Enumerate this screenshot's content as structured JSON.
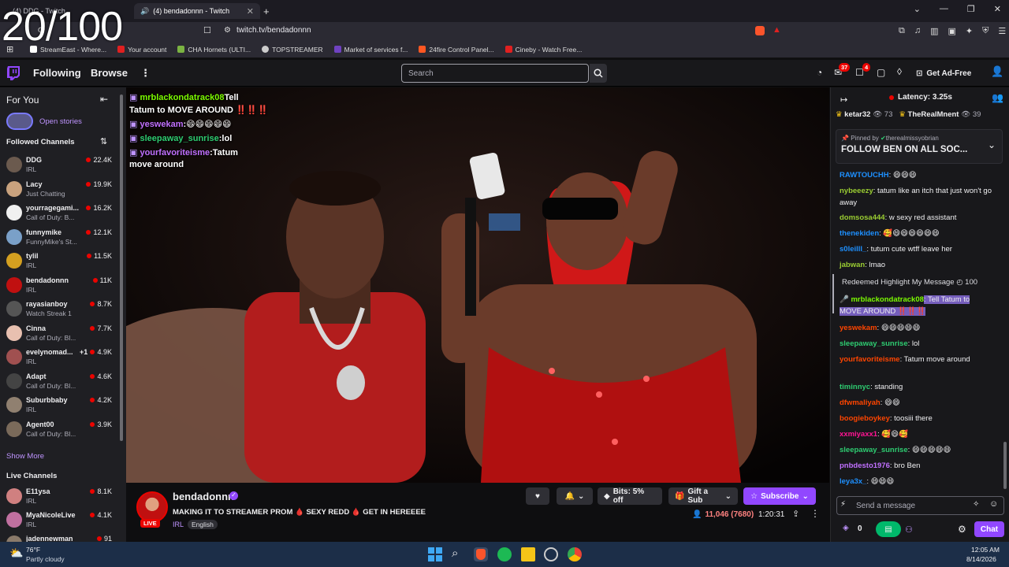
{
  "overlay_counter": "20/100",
  "browser": {
    "tabs": [
      {
        "label": "(4) DDG - Twitch"
      },
      {
        "label": "(4) bendadonnn - Twitch"
      }
    ],
    "url": "twitch.tv/bendadonnn",
    "bookmarks": [
      {
        "label": "StreamEast - Where...",
        "color": "#ffffff"
      },
      {
        "label": "Your account",
        "color": "#e02020"
      },
      {
        "label": "CHA Hornets (ULTI...",
        "color": "#7bb342"
      },
      {
        "label": "TOPSTREAMER",
        "color": "#cccccc"
      },
      {
        "label": "Market of services f...",
        "color": "#6f42c1"
      },
      {
        "label": "24fire Control Panel...",
        "color": "#ff5722"
      },
      {
        "label": "Cineby - Watch Free...",
        "color": "#e02020"
      }
    ]
  },
  "topnav": {
    "following": "Following",
    "browse": "Browse",
    "more": "⋮",
    "search_placeholder": "Search",
    "notif_count_1": "37",
    "notif_count_2": "4",
    "ad_free": "Get Ad-Free"
  },
  "sidebar": {
    "for_you": "For You",
    "open_stories": "Open stories",
    "followed_channels": "Followed Channels",
    "channels": [
      {
        "name": "DDG",
        "game": "IRL",
        "viewers": "22.4K",
        "color": "#6b5a4e"
      },
      {
        "name": "Lacy",
        "game": "Just Chatting",
        "viewers": "19.9K",
        "color": "#c9a27e"
      },
      {
        "name": "yourragegami...",
        "game": "Call of Duty: B...",
        "viewers": "16.2K",
        "color": "#f0f0f0"
      },
      {
        "name": "funnymike",
        "game": "FunnyMike's St...",
        "viewers": "12.1K",
        "color": "#7aa0c8"
      },
      {
        "name": "tylil",
        "game": "IRL",
        "viewers": "11.5K",
        "color": "#d4a020"
      },
      {
        "name": "bendadonnn",
        "game": "IRL",
        "viewers": "11K",
        "color": "#c01010"
      },
      {
        "name": "rayasianboy",
        "game": "Watch Streak 1",
        "viewers": "8.7K",
        "color": "#555555"
      },
      {
        "name": "Cinna",
        "game": "Call of Duty: Bl...",
        "viewers": "7.7K",
        "color": "#e8c0b0"
      },
      {
        "name": "evelynomad...",
        "extra": "+1",
        "game": "IRL",
        "viewers": "4.9K",
        "color": "#a05050"
      },
      {
        "name": "Adapt",
        "game": "Call of Duty: Bl...",
        "viewers": "4.6K",
        "color": "#444444"
      },
      {
        "name": "Suburbbaby",
        "game": "IRL",
        "viewers": "4.2K",
        "color": "#908070"
      },
      {
        "name": "Agent00",
        "game": "Call of Duty: Bl...",
        "viewers": "3.9K",
        "color": "#7a6a5a"
      }
    ],
    "show_more": "Show More",
    "live_channels": "Live Channels",
    "live": [
      {
        "name": "E11ysa",
        "game": "IRL",
        "viewers": "8.1K",
        "color": "#d08080"
      },
      {
        "name": "MyaNicoleLive",
        "game": "IRL",
        "viewers": "4.1K",
        "color": "#c070a0"
      },
      {
        "name": "jadennewman",
        "game": "",
        "viewers": "91",
        "color": "#8a7a6a"
      }
    ]
  },
  "video_overlay_chat": [
    {
      "user": "mrblackondatrack08",
      "user_color": "#7cfc00",
      "text": "Tell"
    },
    {
      "user": "",
      "user_color": "#ffffff",
      "text": "Tatum to MOVE AROUND ‼️‼️‼️"
    },
    {
      "user": "yeswekam",
      "user_color": "#c070ff",
      "text": ":😄😄😄😄😄"
    },
    {
      "user": "sleepaway_sunrise",
      "user_color": "#2ecc71",
      "text": ":lol"
    },
    {
      "user": "yourfavoriteisme",
      "user_color": "#c070ff",
      "text": ":Tatum"
    },
    {
      "user": "",
      "user_color": "#ffffff",
      "text": "move around"
    }
  ],
  "stream": {
    "channel": "bendadonnn",
    "live_label": "LIVE",
    "title": "MAKING IT TO STREAMER PROM 🩸 SEXY REDD 🩸 GET IN HEREEEE",
    "tags": [
      "IRL",
      "English"
    ],
    "bits": "Bits: 5% off",
    "gift": "Gift a Sub",
    "subscribe": "Subscribe",
    "viewers": "11,046 (7680)",
    "uptime": "1:20:31"
  },
  "chat": {
    "latency": "Latency: 3.25s",
    "top_gifters": [
      {
        "name": "ketar32",
        "count": "73"
      },
      {
        "name": "TheRealMnent",
        "count": "39"
      }
    ],
    "pinned_by_label": "Pinned by",
    "pinned_by": "therealmissyobrian",
    "pinned_text": "FOLLOW BEN ON ALL SOC...",
    "messages": [
      {
        "user": "RAWTOUCHH",
        "color": "#1e90ff",
        "text": ": 😄😄😄"
      },
      {
        "user": "nybeeezy",
        "color": "#9acd32",
        "text": ": tatum like an itch that just won't go away"
      },
      {
        "user": "domsosa444",
        "color": "#9acd32",
        "text": ": w sexy red assistant"
      },
      {
        "user": "thenekiden",
        "color": "#1e90ff",
        "text": ": 🥰😄😄😄😄😄😄"
      },
      {
        "user": "s0leilll_",
        "color": "#1e90ff",
        "text": ": tutum cute wtff leave her"
      },
      {
        "user": "jabwan",
        "color": "#9acd32",
        "text": ": lmao"
      },
      {
        "user": "yeswekam",
        "color": "#ff4500",
        "text": ": 😄😄😄😄😄"
      },
      {
        "user": "sleepaway_sunrise",
        "color": "#2ecc71",
        "text": ": lol"
      },
      {
        "user": "yourfavoriteisme",
        "color": "#ff4500",
        "text": ": Tatum move around"
      },
      {
        "user": "timinnyc",
        "color": "#2ecc71",
        "text": ": standing"
      },
      {
        "user": "dfwmaliyah",
        "color": "#ff4500",
        "text": ": 😄😄"
      },
      {
        "user": "boogieboykey",
        "color": "#ff4500",
        "text": ": toosiii there"
      },
      {
        "user": "xxmiyaxx1",
        "color": "#ff1493",
        "text": ": 🥰😄🥰"
      },
      {
        "user": "sleepaway_sunrise",
        "color": "#2ecc71",
        "text": ": 😄😄😄😄😄"
      },
      {
        "user": "pnbdesto1976",
        "color": "#c070ff",
        "text": ": bro Ben"
      },
      {
        "user": "leya3x_",
        "color": "#1e90ff",
        "text": ": 😄😄😄"
      }
    ],
    "redeemed_label": "Redeemed Highlight My Message",
    "redeemed_cost": "100",
    "highlight_user": "mrblackondatrack08",
    "highlight_text": ": Tell Tatum to MOVE AROUND ‼️‼️‼️",
    "input_placeholder": "Send a message",
    "points": "0",
    "chat_button": "Chat"
  },
  "taskbar": {
    "temp": "76°F",
    "weather": "Partly cloudy",
    "time": "12:05 AM",
    "date": "8/14/2026"
  },
  "colors": {
    "twitch_purple": "#9147ff",
    "live_red": "#eb0400",
    "sidebar_bg": "#1f1f23",
    "chat_bg": "#18181b"
  }
}
